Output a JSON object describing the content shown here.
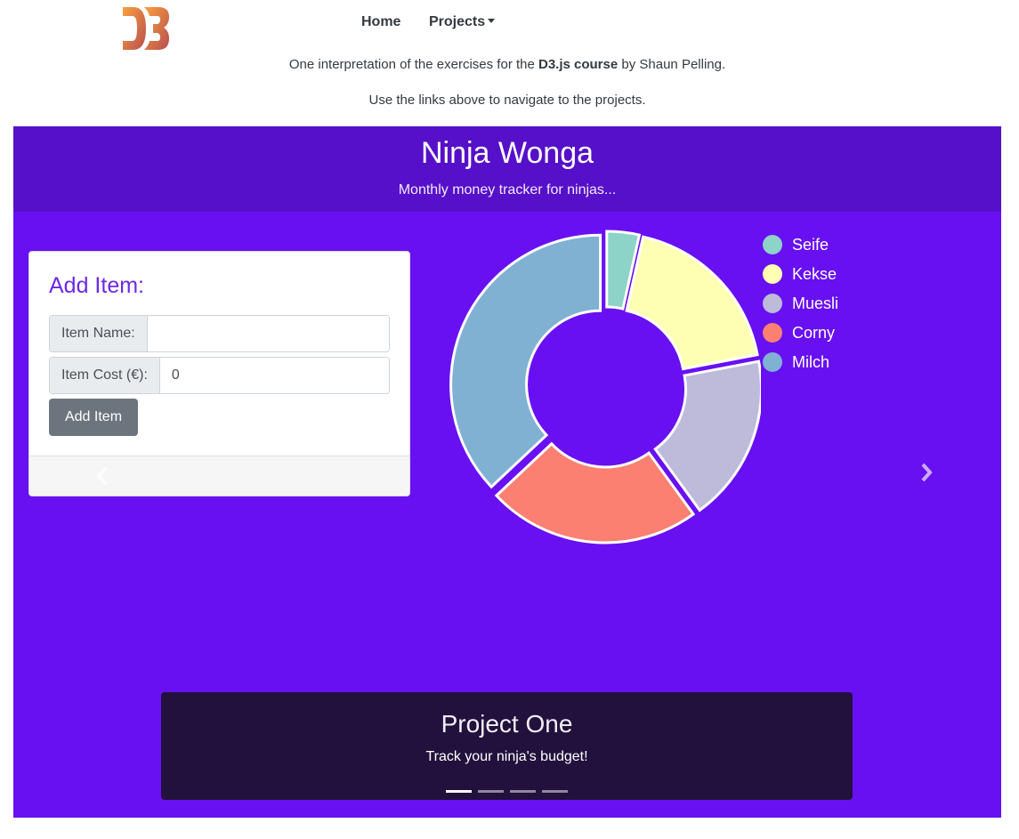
{
  "nav": {
    "logo_text": "D3",
    "home": "Home",
    "projects": "Projects"
  },
  "intro": {
    "part1": "One interpretation of the exercises for the ",
    "course": "D3.js course",
    "part2": " by Shaun Pelling.",
    "line2": "Use the links above to navigate to the projects."
  },
  "app": {
    "title": "Ninja Wonga",
    "subtitle": "Monthly money tracker for ninjas..."
  },
  "form": {
    "title": "Add Item:",
    "name_label": "Item Name:",
    "name_value": "",
    "cost_label": "Item Cost (€):",
    "cost_value": "0",
    "button": "Add Item"
  },
  "chart_data": {
    "type": "pie",
    "categories": [
      "Seife",
      "Kekse",
      "Muesli",
      "Corny",
      "Milch"
    ],
    "values": [
      3.5,
      18.5,
      18,
      23,
      37
    ],
    "colors": [
      "#8dd3c7",
      "#ffffb3",
      "#bebada",
      "#fb8072",
      "#80b1d3"
    ],
    "legend_position": "right"
  },
  "caption": {
    "title": "Project One",
    "text": "Track your ninja's budget!"
  },
  "carousel": {
    "slide_count": 4,
    "active_index": 0
  },
  "icons": {
    "prev": "chevron-left-icon",
    "next": "chevron-right-icon"
  }
}
